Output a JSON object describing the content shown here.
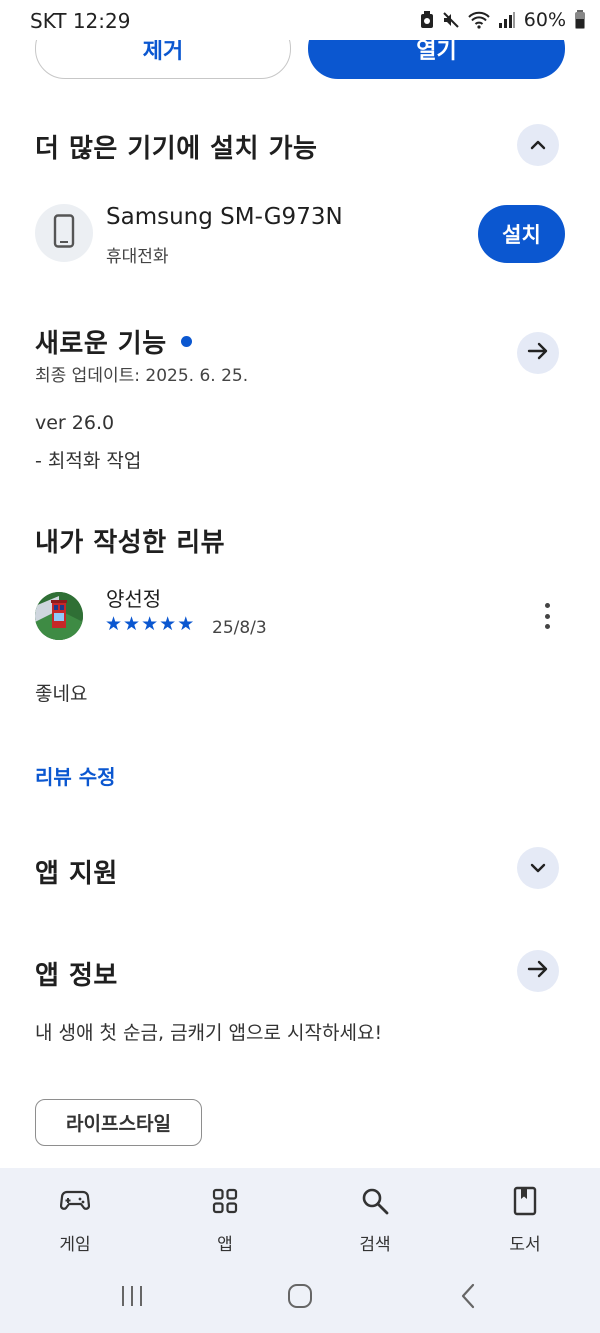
{
  "status_bar": {
    "time": "SKT 12:29",
    "battery": "60%"
  },
  "top_buttons": {
    "remove_label": "제거",
    "open_label": "열기"
  },
  "more_devices": {
    "title": "더 많은 기기에 설치 가능",
    "device": {
      "name": "Samsung SM-G973N",
      "type": "휴대전화",
      "install_label": "설치"
    }
  },
  "whats_new": {
    "title": "새로운 기능",
    "updated": "최종 업데이트: 2025. 6. 25.",
    "version": "ver 26.0",
    "note": "- 최적화 작업"
  },
  "my_review": {
    "title": "내가 작성한 리뷰",
    "reviewer": "양선정",
    "rating": 5,
    "stars": [
      "★",
      "★",
      "★",
      "★",
      "★"
    ],
    "date": "25/8/3",
    "text": "좋네요",
    "edit_label": "리뷰 수정"
  },
  "app_support": {
    "title": "앱 지원"
  },
  "app_info": {
    "title": "앱 정보",
    "description": "내 생애 첫 순금, 금캐기 앱으로 시작하세요!",
    "category": "라이프스타일"
  },
  "bottom_nav": {
    "items": [
      {
        "label": "게임",
        "icon": "gamepad-icon"
      },
      {
        "label": "앱",
        "icon": "apps-grid-icon"
      },
      {
        "label": "검색",
        "icon": "search-icon"
      },
      {
        "label": "도서",
        "icon": "book-icon"
      }
    ]
  },
  "colors": {
    "accent": "#0b57d0",
    "circle_button_bg": "#e5eaf6",
    "nav_bg": "#eef1f8"
  }
}
